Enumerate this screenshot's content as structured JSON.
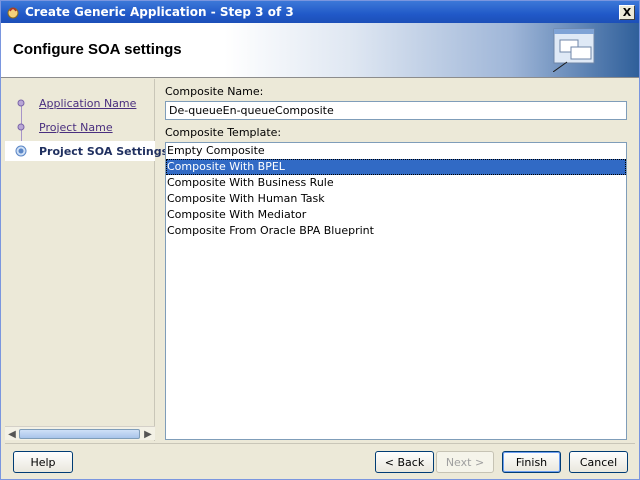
{
  "window": {
    "title": "Create Generic Application - Step 3 of 3",
    "close_label": "X"
  },
  "banner": {
    "title": "Configure SOA settings"
  },
  "nav": {
    "items": [
      {
        "label": "Application Name",
        "state": "done"
      },
      {
        "label": "Project Name",
        "state": "done"
      },
      {
        "label": "Project SOA Settings",
        "state": "current"
      }
    ]
  },
  "form": {
    "composite_name_label": "Composite Name:",
    "composite_name_value": "De-queueEn-queueComposite",
    "composite_template_label": "Composite Template:",
    "templates": [
      "Empty Composite",
      "Composite With BPEL",
      "Composite With Business Rule",
      "Composite With Human Task",
      "Composite With Mediator",
      "Composite From Oracle BPA Blueprint"
    ],
    "selected_template": "Composite With BPEL"
  },
  "buttons": {
    "help": "Help",
    "back": "< Back",
    "next": "Next >",
    "finish": "Finish",
    "cancel": "Cancel"
  },
  "colors": {
    "title_bar": "#2159c8",
    "selection": "#316ac5",
    "link": "#4a2f7f"
  }
}
